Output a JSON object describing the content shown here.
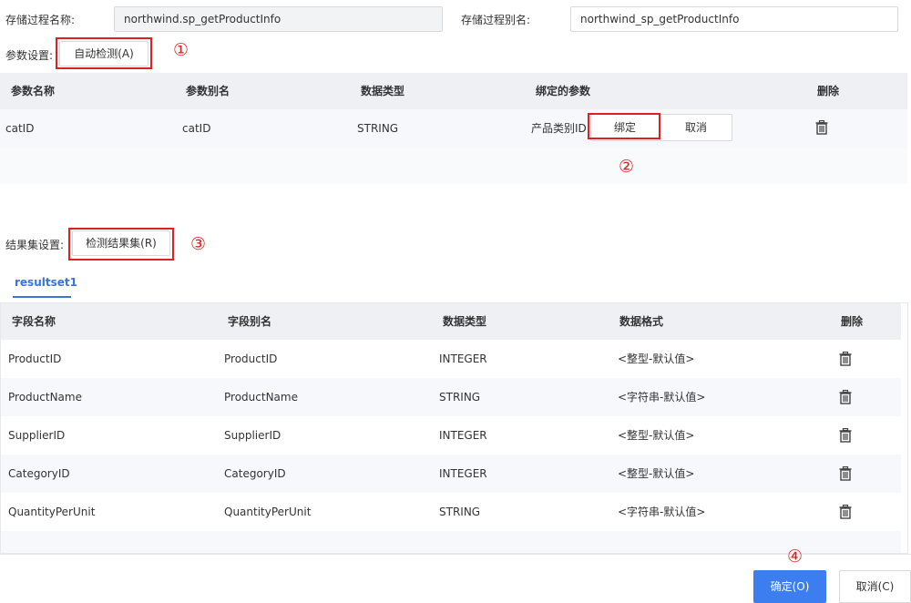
{
  "proc": {
    "name_label": "存储过程名称:",
    "name_value": "northwind.sp_getProductInfo",
    "alias_label": "存储过程别名:",
    "alias_value": "northwind_sp_getProductInfo"
  },
  "params": {
    "label": "参数设置:",
    "auto_detect": "自动检测(A)",
    "columns": [
      "参数名称",
      "参数别名",
      "数据类型",
      "绑定的参数",
      "删除"
    ],
    "rows": [
      {
        "name": "catID",
        "alias": "catID",
        "type": "STRING",
        "bound": "产品类别ID",
        "bind_btn": "绑定",
        "cancel_btn": "取消"
      }
    ]
  },
  "resultset": {
    "label": "结果集设置:",
    "detect": "检测结果集(R)",
    "tab": "resultset1",
    "columns": [
      "字段名称",
      "字段别名",
      "数据类型",
      "数据格式",
      "删除"
    ],
    "rows": [
      {
        "name": "ProductID",
        "alias": "ProductID",
        "type": "INTEGER",
        "format": "<整型-默认值>"
      },
      {
        "name": "ProductName",
        "alias": "ProductName",
        "type": "STRING",
        "format": "<字符串-默认值>"
      },
      {
        "name": "SupplierID",
        "alias": "SupplierID",
        "type": "INTEGER",
        "format": "<整型-默认值>"
      },
      {
        "name": "CategoryID",
        "alias": "CategoryID",
        "type": "INTEGER",
        "format": "<整型-默认值>"
      },
      {
        "name": "QuantityPerUnit",
        "alias": "QuantityPerUnit",
        "type": "STRING",
        "format": "<字符串-默认值>"
      }
    ]
  },
  "annotations": [
    "①",
    "②",
    "③",
    "④"
  ],
  "footer": {
    "ok": "确定(O)",
    "cancel": "取消(C)"
  },
  "colors": {
    "accent": "#3c7ef0",
    "highlight": "#e02020",
    "header_bg": "#eef0f4"
  },
  "icons": {
    "delete": "trash-icon"
  }
}
